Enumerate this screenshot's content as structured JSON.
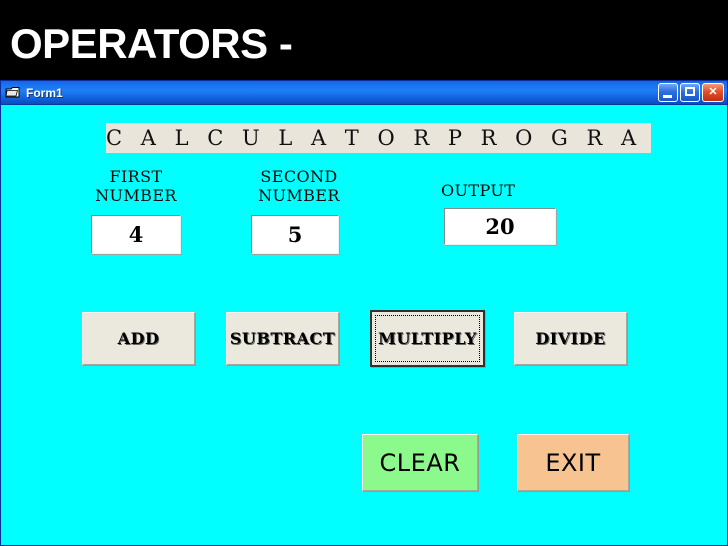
{
  "slide": {
    "title": "OPERATORS -",
    "background_color": "#000000",
    "title_color": "#ffffff"
  },
  "window": {
    "title": "Form1",
    "icon": "vb-form-icon",
    "background_color": "#00ffff",
    "titlebar_color": "#1874f0",
    "controls": [
      {
        "name": "minimize",
        "glyph": "_"
      },
      {
        "name": "maximize",
        "glyph": "□"
      },
      {
        "name": "close",
        "glyph": "✕"
      }
    ]
  },
  "form": {
    "header_label": "C A L C U L A T O R    P R O G R A M",
    "header_background": "#e9e5da",
    "labels": {
      "first_number": "FIRST\nNUMBER",
      "second_number": "SECOND\nNUMBER",
      "output": "OUTPUT"
    },
    "inputs": {
      "first_number": {
        "value": "4",
        "placeholder": ""
      },
      "second_number": {
        "value": "5",
        "placeholder": ""
      },
      "output": {
        "value": "20",
        "placeholder": ""
      }
    },
    "operator_buttons": [
      {
        "id": "add",
        "label": "ADD",
        "focused": false
      },
      {
        "id": "subtract",
        "label": "SUBTRACT",
        "focused": false
      },
      {
        "id": "multiply",
        "label": "MULTIPLY",
        "focused": true
      },
      {
        "id": "divide",
        "label": "DIVIDE",
        "focused": false
      }
    ],
    "action_buttons": [
      {
        "id": "clear",
        "label": "CLEAR",
        "color": "#8cf98c"
      },
      {
        "id": "exit",
        "label": "EXIT",
        "color": "#f7c491"
      }
    ]
  }
}
